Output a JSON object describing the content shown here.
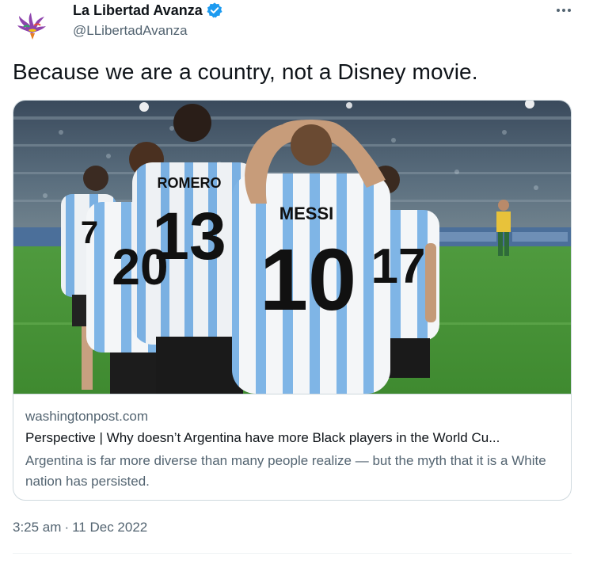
{
  "author": {
    "display_name": "La Libertad Avanza",
    "handle": "@LLibertadAvanza",
    "verified": true,
    "verified_color": "#1d9bf0"
  },
  "tweet": {
    "text": "Because we are a country, not a Disney movie."
  },
  "card": {
    "image_icon": "photo-football-players",
    "domain": "washingtonpost.com",
    "title": "Perspective | Why doesn’t Argentina have more Black players in the World Cu...",
    "description": "Argentina is far more diverse than many people realize — but the myth that it is a White nation has persisted.",
    "jersey_texts": [
      "MESSI",
      "10",
      "ROMERO",
      "13",
      "20",
      "17",
      "7"
    ]
  },
  "meta": {
    "time": "3:25 am",
    "separator": "·",
    "date": "11 Dec 2022"
  },
  "colors": {
    "text": "#0f1419",
    "secondary": "#536471",
    "border": "#cfd9de"
  }
}
